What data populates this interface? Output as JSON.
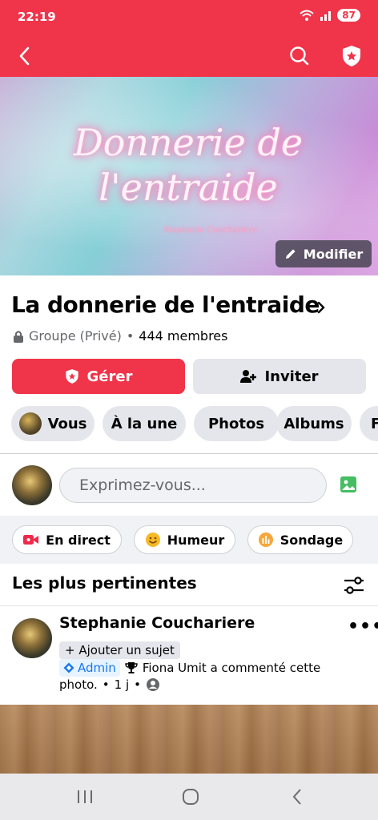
{
  "status_bar": {
    "time": "22:19",
    "battery": "87"
  },
  "cover": {
    "title_line1": "Donnerie de",
    "title_line2": "l'entraide",
    "signature": "Stephanie Couchariere",
    "edit_label": "Modifier"
  },
  "group": {
    "name": "La donnerie de l'entraide",
    "privacy": "Groupe (Privé)",
    "separator": "•",
    "members": "444 membres"
  },
  "actions": {
    "manage_label": "Gérer",
    "invite_label": "Inviter"
  },
  "tabs": [
    {
      "label": "Vous"
    },
    {
      "label": "À la une"
    },
    {
      "label": "Photos"
    },
    {
      "label": "Albums"
    },
    {
      "label": "F"
    }
  ],
  "composer": {
    "placeholder": "Exprimez-vous..."
  },
  "chips": {
    "live": "En direct",
    "mood": "Humeur",
    "poll": "Sondage"
  },
  "feed": {
    "sort_label": "Les plus pertinentes"
  },
  "post": {
    "author": "Stephanie Couchariere",
    "more": "•••",
    "topic": "+ Ajouter un sujet",
    "admin": "Admin",
    "activity": "Fiona Umit a commenté cette",
    "activity_cont": "photo.",
    "time": "1 j",
    "dot": "•"
  },
  "colors": {
    "brand": "#f0344a",
    "tab_bg": "#e4e6eb",
    "link_blue": "#1877f2"
  },
  "icons": [
    "back-arrow-icon",
    "search-icon",
    "admin-shield-icon",
    "pencil-icon",
    "lock-icon",
    "chevron-right-icon",
    "invite-person-icon",
    "photo-icon",
    "live-video-icon",
    "mood-icon",
    "poll-icon",
    "filter-sliders-icon",
    "trophy-icon",
    "privacy-friends-icon"
  ]
}
